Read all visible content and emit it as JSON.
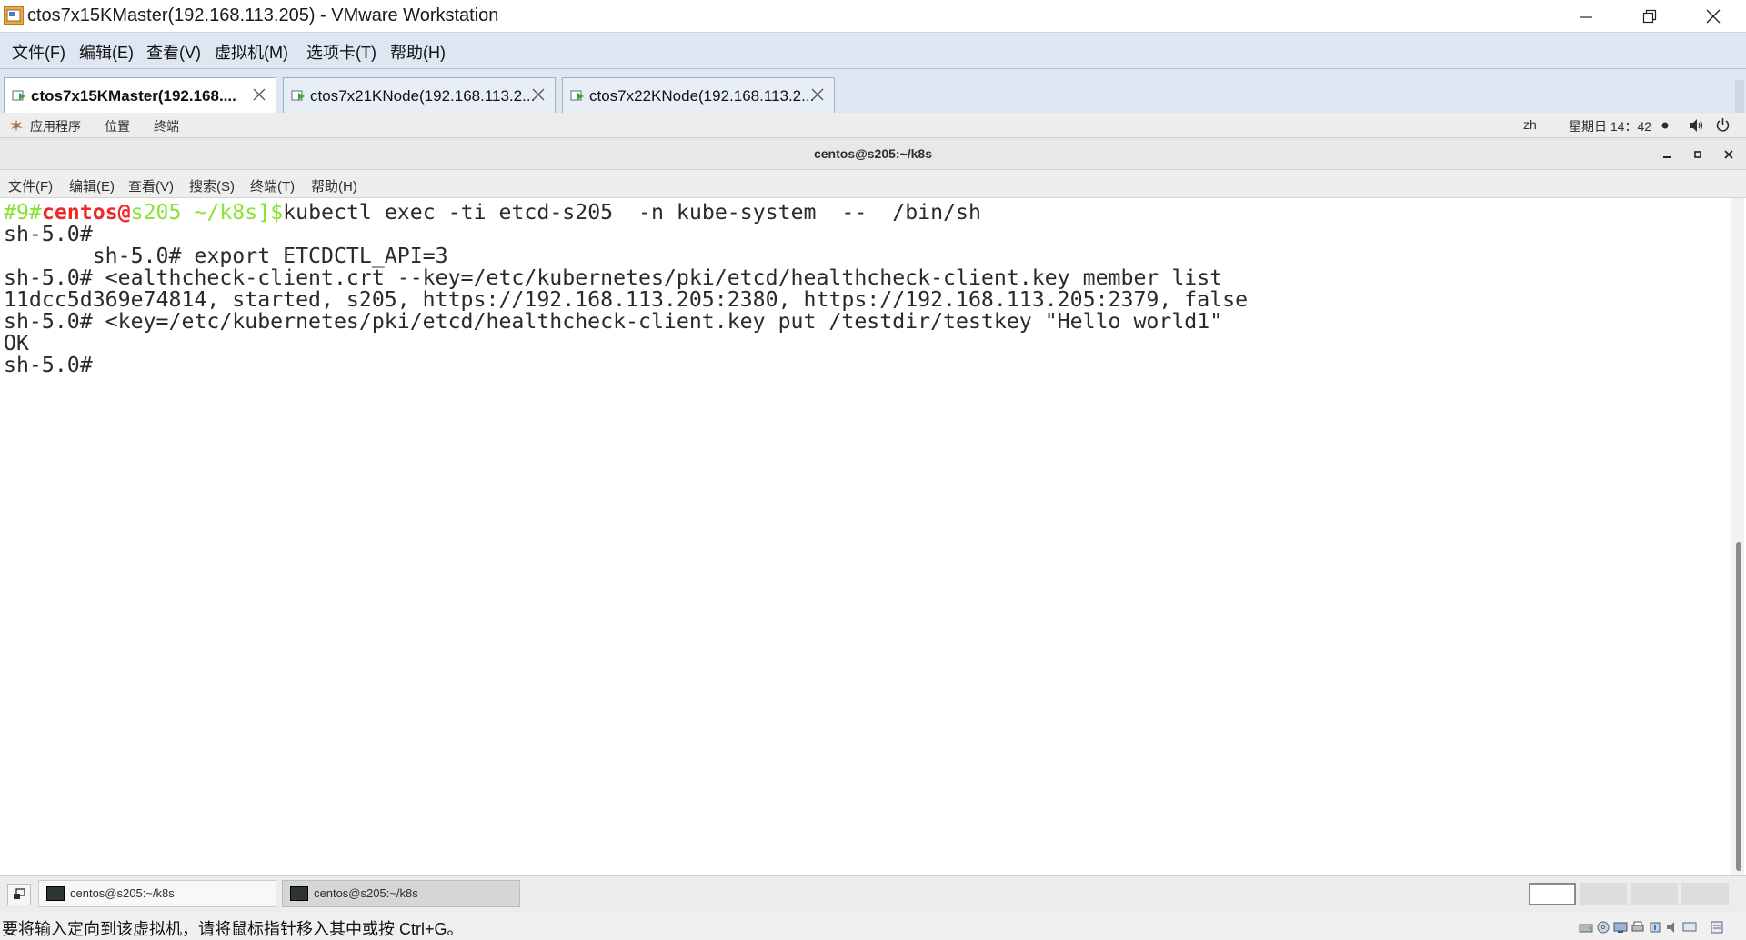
{
  "window": {
    "title": "ctos7x15KMaster(192.168.113.205) - VMware Workstation"
  },
  "menu": {
    "items": [
      {
        "label": "文件(F)"
      },
      {
        "label": "编辑(E)"
      },
      {
        "label": "查看(V)"
      },
      {
        "label": "虚拟机(M)"
      },
      {
        "label": "选项卡(T)"
      },
      {
        "label": "帮助(H)"
      }
    ]
  },
  "tabs": [
    {
      "label": "ctos7x15KMaster(192.168....",
      "active": true
    },
    {
      "label": "ctos7x21KNode(192.168.113.2...",
      "active": false
    },
    {
      "label": "ctos7x22KNode(192.168.113.2...",
      "active": false
    }
  ],
  "gnome_bar": {
    "applications": "应用程序",
    "places": "位置",
    "terminal": "终端",
    "input_method": "zh",
    "clock": "星期日 14：42"
  },
  "terminal_window": {
    "title": "centos@s205:~/k8s",
    "menu": [
      "文件(F)",
      "编辑(E)",
      "查看(V)",
      "搜索(S)",
      "终端(T)",
      "帮助(H)"
    ]
  },
  "terminal": {
    "prompt": {
      "hist": "#9#",
      "user": "centos@",
      "host": "s205",
      "path": " ~/k8s]",
      "dollar": "$",
      "command": "kubectl exec -ti etcd-s205  -n kube-system  --  /bin/sh"
    },
    "lines": [
      "sh-5.0#",
      "       sh-5.0# export ETCDCTL_API=3",
      "sh-5.0# <ealthcheck-client.crt --key=/etc/kubernetes/pki/etcd/healthcheck-client.key member list",
      "11dcc5d369e74814, started, s205, https://192.168.113.205:2380, https://192.168.113.205:2379, false",
      "sh-5.0# <key=/etc/kubernetes/pki/etcd/healthcheck-client.key put /testdir/testkey \"Hello world1\"",
      "OK",
      "sh-5.0#"
    ]
  },
  "window_list": {
    "items": [
      {
        "label": "centos@s205:~/k8s",
        "active": false
      },
      {
        "label": "centos@s205:~/k8s",
        "active": true
      }
    ]
  },
  "status_bar": {
    "text": "要将输入定向到该虚拟机，请将鼠标指针移入其中或按 Ctrl+G。"
  },
  "colors": {
    "prompt_hist": "#8ae234",
    "prompt_user": "#ef2929",
    "prompt_path": "#8ae234",
    "terminal_text": "#2a2a2a",
    "menubar_bg": "#dde6f1"
  }
}
